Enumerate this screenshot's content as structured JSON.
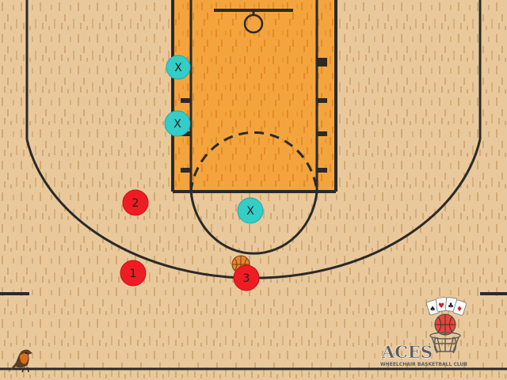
{
  "colors": {
    "floor": "#e9c99b",
    "floor_grain": "#d2a874",
    "paint": "#f4a43c",
    "paint_grain": "#e5892a",
    "lines": "#2a2a2a",
    "offense": "#f01c24",
    "defense": "#34cdc8",
    "ball": "#e7852c",
    "logo": "#5b5b5b"
  },
  "offense": [
    {
      "label": "1"
    },
    {
      "label": "2"
    },
    {
      "label": "3"
    }
  ],
  "defense": [
    {
      "label": "X"
    },
    {
      "label": "X"
    },
    {
      "label": "X"
    }
  ],
  "logo": {
    "name": "ACES",
    "tagline": "WHEELCHAIR BASKETBALL CLUB",
    "suits": [
      "♠",
      "♥",
      "♣",
      "♦"
    ]
  },
  "mascot": "robin-bird"
}
